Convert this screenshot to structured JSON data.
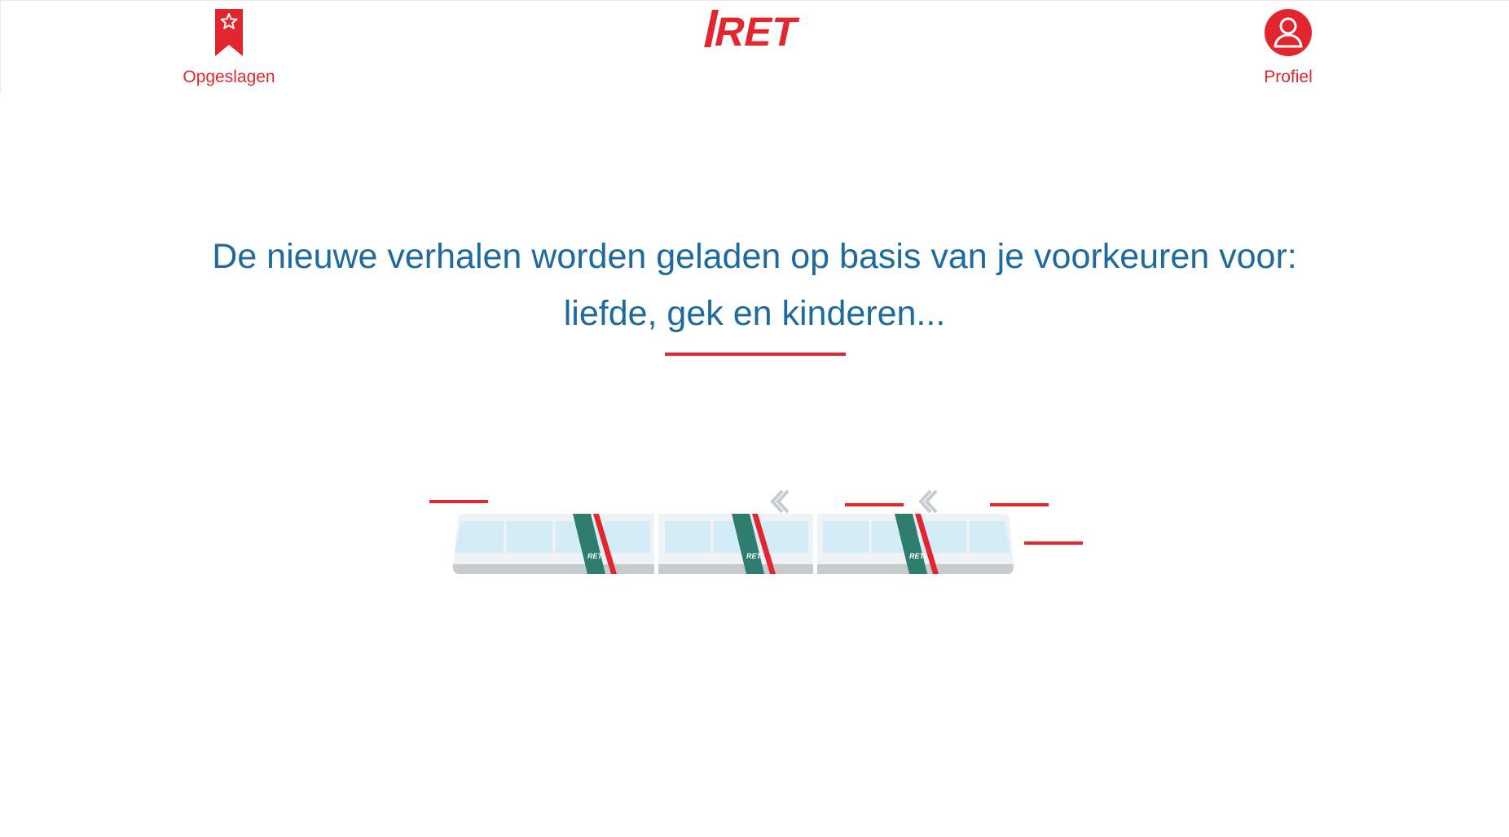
{
  "header": {
    "saved": {
      "label": "Opgeslagen",
      "icon": "bookmark-star-icon"
    },
    "logo": {
      "text": "RET"
    },
    "profile": {
      "label": "Profiel",
      "icon": "user-icon"
    }
  },
  "message": {
    "line1": "De nieuwe verhalen worden geladen op basis van je voorkeuren voor:",
    "line2": "liefde, gek en kinderen..."
  },
  "tram": {
    "badge": "RET"
  },
  "colors": {
    "brand_red": "#e3262e",
    "text_blue": "#1d6a9c",
    "tram_green": "#2e7d6f",
    "tram_window": "#d3ebf7",
    "tram_body": "#eef2f5",
    "tram_base": "#c6cbd0"
  }
}
